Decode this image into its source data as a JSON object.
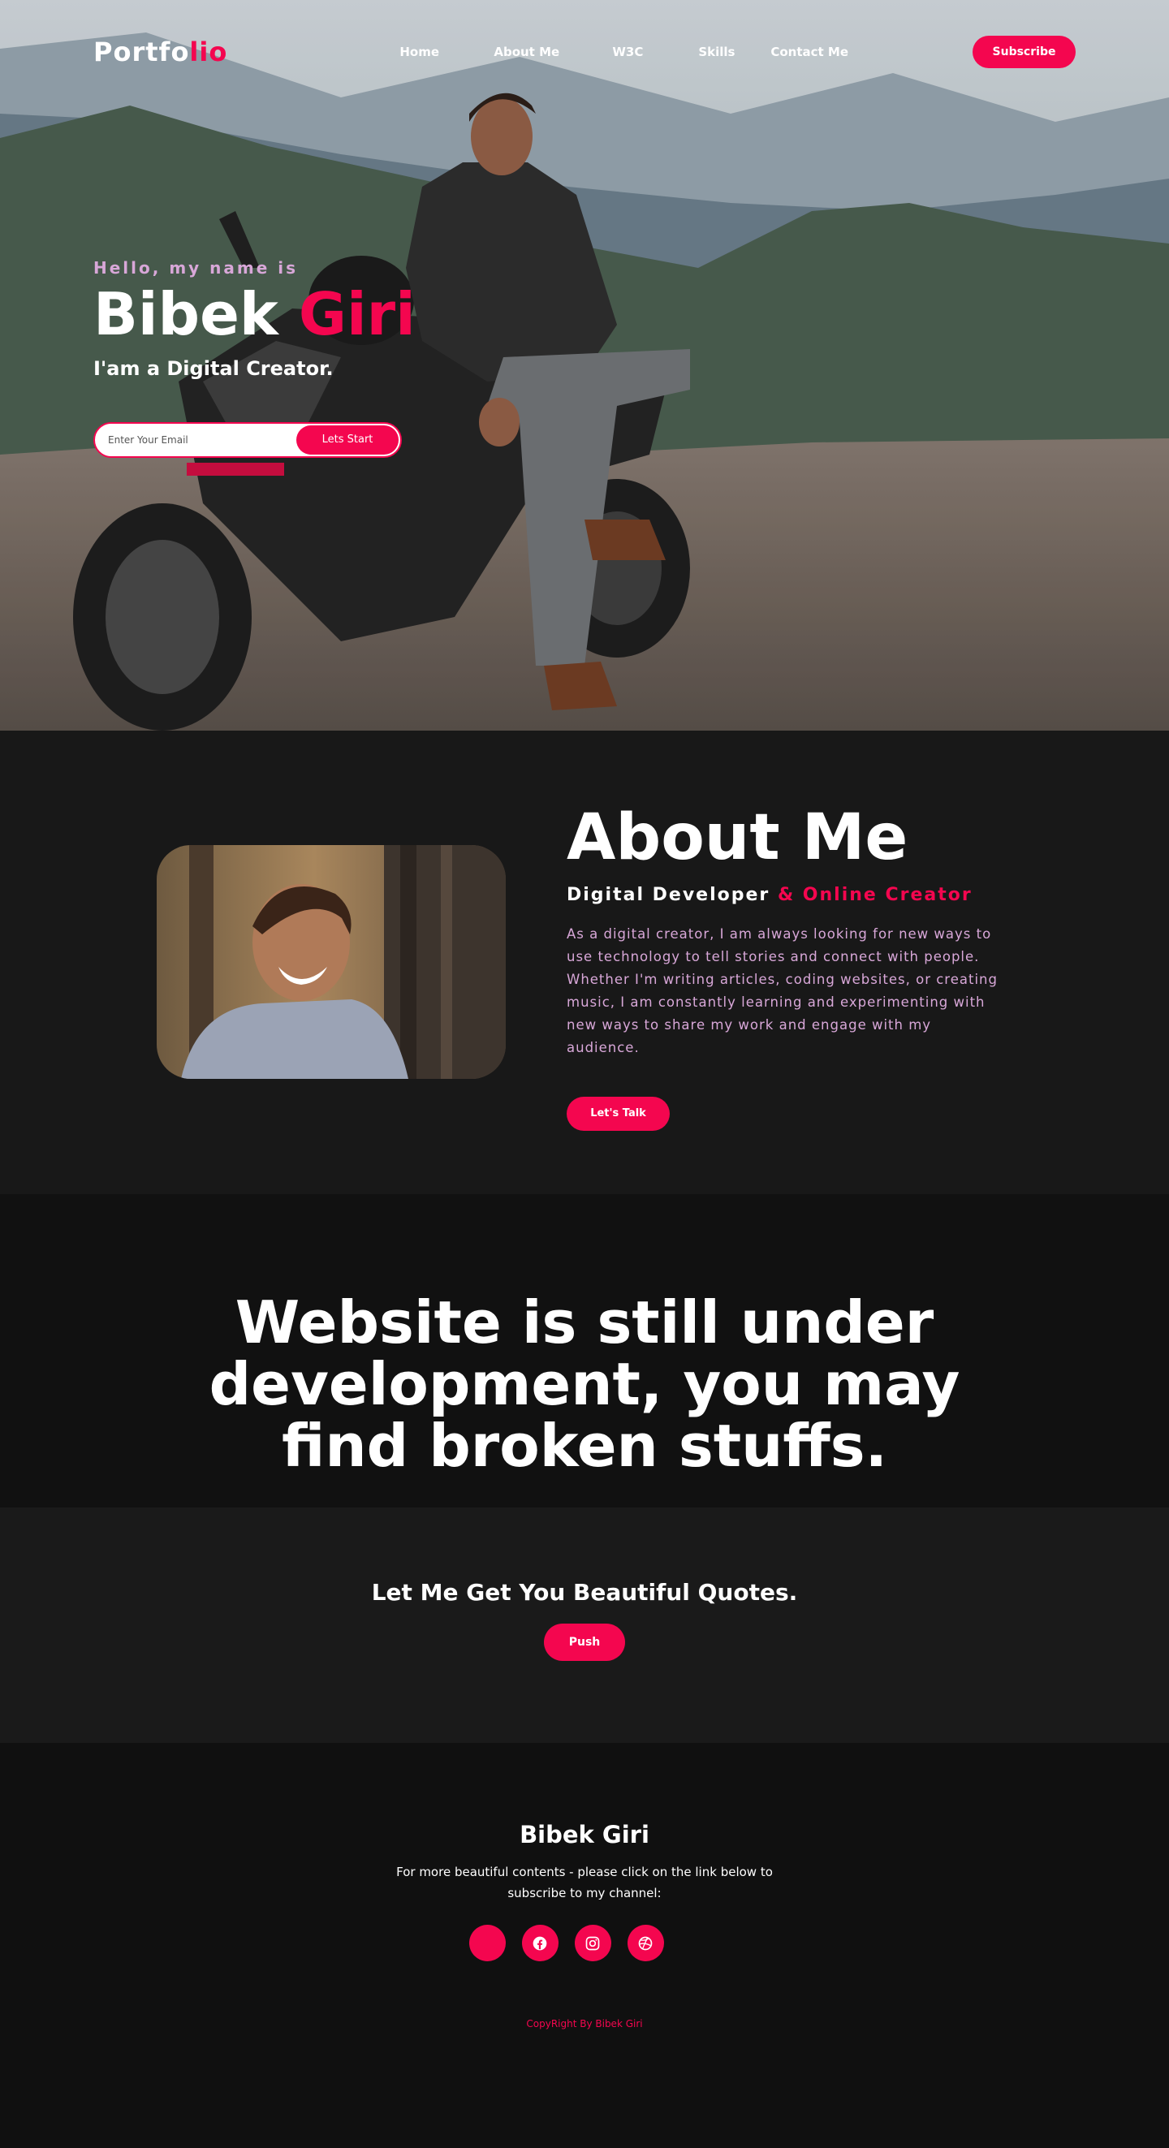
{
  "nav": {
    "logo_main": "Portfo",
    "logo_accent": "lio",
    "links": [
      "Home",
      "About Me",
      "W3C",
      "Skills",
      "Contact Me"
    ],
    "subscribe_label": "Subscribe"
  },
  "hero": {
    "greeting": "Hello, my name is",
    "first_name": "Bibek",
    "last_name": "Giri",
    "tagline": "I'am a Digital Creator.",
    "email_placeholder": "Enter Your Email",
    "cta_label": "Lets Start"
  },
  "about": {
    "title": "About Me",
    "subtitle_main": "Digital Developer",
    "subtitle_accent": "& Online Creator",
    "body": "As a digital creator, I am always looking for new ways to use technology to tell stories and connect with people. Whether I'm writing articles, coding websites, or creating music, I am constantly learning and experimenting with new ways to share my work and engage with my audience.",
    "cta_label": "Let's Talk"
  },
  "notice": {
    "text": "Website is still under development, you may find broken stuffs."
  },
  "quotes": {
    "title": "Let Me Get You Beautiful Quotes.",
    "button_label": "Push"
  },
  "footer": {
    "name": "Bibek Giri",
    "description": "For more beautiful contents - please click on the link below to subscribe to my channel:",
    "socials": [
      "blank-icon",
      "facebook-icon",
      "instagram-icon",
      "dribbble-icon"
    ],
    "copyright": "CopyRight By Bibek Giri"
  },
  "colors": {
    "accent": "#f4064f",
    "lavender": "#d8a7d8",
    "dark": "#181818"
  }
}
